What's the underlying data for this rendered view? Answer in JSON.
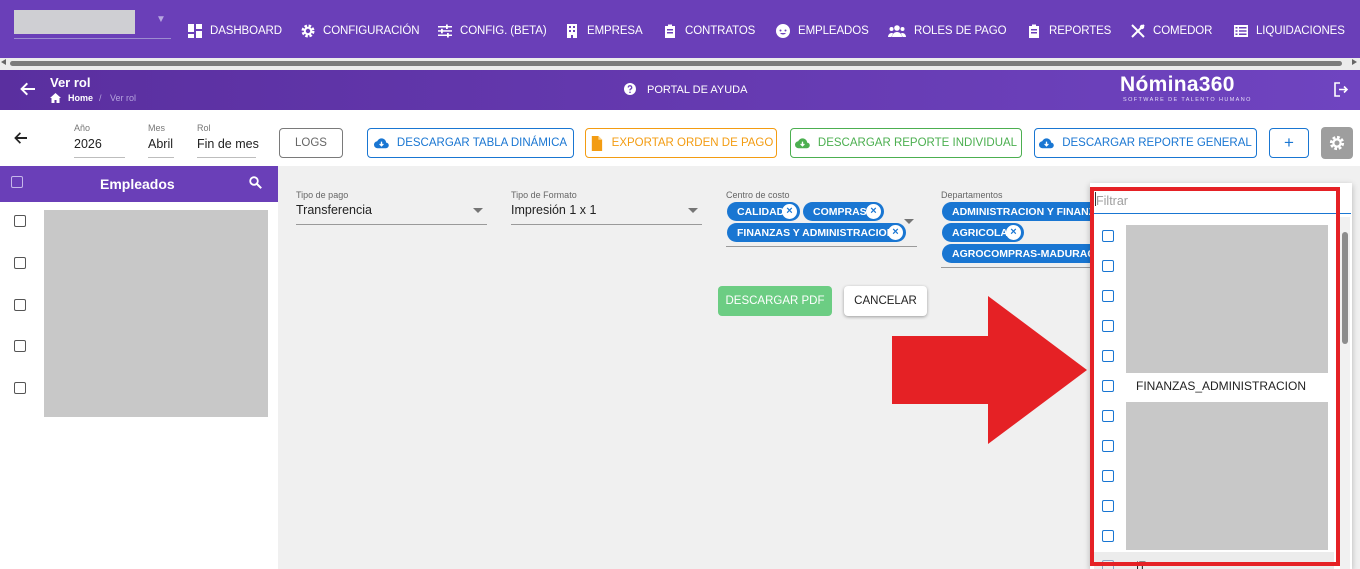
{
  "nav": {
    "items": [
      {
        "label": "DASHBOARD",
        "icon": "dashboard-icon"
      },
      {
        "label": "CONFIGURACIÓN",
        "icon": "gear-icon"
      },
      {
        "label": "CONFIG. (BETA)",
        "icon": "sliders-icon"
      },
      {
        "label": "EMPRESA",
        "icon": "building-icon"
      },
      {
        "label": "CONTRATOS",
        "icon": "clipboard-icon"
      },
      {
        "label": "EMPLEADOS",
        "icon": "face-icon"
      },
      {
        "label": "ROLES DE PAGO",
        "icon": "group-icon"
      },
      {
        "label": "REPORTES",
        "icon": "clipboard-icon"
      },
      {
        "label": "COMEDOR",
        "icon": "utensils-icon"
      },
      {
        "label": "LIQUIDACIONES",
        "icon": "list-icon"
      }
    ]
  },
  "header": {
    "title": "Ver rol",
    "breadcrumb_home": "Home",
    "breadcrumb_sep": "/",
    "breadcrumb_current": "Ver rol",
    "help_label": "PORTAL DE AYUDA",
    "brand": "Nómina360",
    "brand_tagline": "SOFTWARE DE TALENTO HUMANO"
  },
  "period": {
    "year_label": "Año",
    "year_value": "2026",
    "month_label": "Mes",
    "month_value": "Abril",
    "role_label": "Rol",
    "role_value": "Fin de mes"
  },
  "toolbar": {
    "logs": "LOGS",
    "pivot": "DESCARGAR TABLA DINÁMICA",
    "export_order": "EXPORTAR ORDEN DE PAGO",
    "individual": "DESCARGAR REPORTE INDIVIDUAL",
    "general": "DESCARGAR REPORTE GENERAL",
    "add": "+"
  },
  "employees": {
    "title": "Empleados",
    "row_count": 5
  },
  "form": {
    "payment_type_label": "Tipo de pago",
    "payment_type_value": "Transferencia",
    "format_label": "Tipo de Formato",
    "format_value": "Impresión 1 x 1",
    "cost_center_label": "Centro de costo",
    "cost_center_chips": [
      "CALIDAD",
      "COMPRAS",
      "FINANZAS Y ADMINISTRACION"
    ],
    "departments_label": "Departamentos",
    "department_chips": [
      "ADMINISTRACION Y FINANZAS",
      "AGRICOLA",
      "AGROCOMPRAS-MADURACION"
    ],
    "download_pdf": "DESCARGAR PDF",
    "cancel": "CANCELAR",
    "chip_remove": "×"
  },
  "dropdown": {
    "filter_placeholder": "Filtrar",
    "item_label": "FINANZAS_ADMINISTRACION",
    "last_item_label": "IT"
  },
  "colors": {
    "nav_bg": "#6a3fb8",
    "primary_blue": "#1976d2",
    "orange": "#f39c12",
    "green": "#4caf50",
    "highlight_red": "#e52125"
  }
}
